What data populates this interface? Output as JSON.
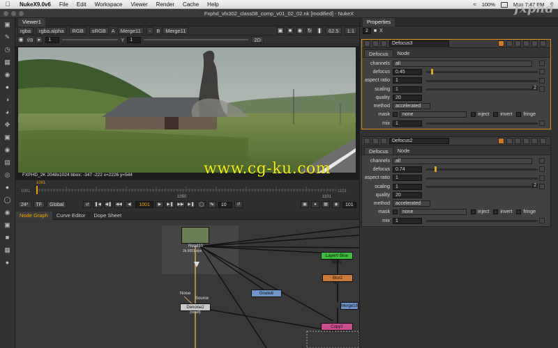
{
  "menubar": {
    "app": "NukeX9.0v6",
    "items": [
      "File",
      "Edit",
      "Workspace",
      "Viewer",
      "Render",
      "Cache",
      "Help"
    ],
    "status_percent": "100%",
    "clock": "Mon 7:47 PM"
  },
  "window": {
    "title": "Fxphd_vfx302_class08_comp_v01_02_02.nk [modified] - NukeX"
  },
  "logo": "fxphd",
  "viewer": {
    "tab": "Viewer1",
    "toolbar1": {
      "channels": "rgba",
      "alpha": "rgba.alpha",
      "colorspace_a": "RGB",
      "lut": "sRGB",
      "input_a_label": "A",
      "input_a": "Merge11",
      "input_b_sep": "-",
      "input_b_label": "B",
      "input_b": "Merge11",
      "zoom": "62.5",
      "ratio": "1:1"
    },
    "toolbar2": {
      "fstop": "f/8",
      "gain": "1",
      "gamma_label": "Y",
      "gamma": "1",
      "view": "2D"
    },
    "info": "FXPHD_2K 2048x1024  bbox: -347 -222   x=2226 y=544"
  },
  "timeline": {
    "start": "1001",
    "mid": "1050",
    "end": "1101",
    "current": "1001",
    "fps": "24*",
    "tf": "TF",
    "global": "Global",
    "skip": "10",
    "end_field": "101"
  },
  "watermark": "www.cg-ku.com",
  "nodegraph": {
    "tabs": [
      "Node Graph",
      "Curve Editor",
      "Dope Sheet"
    ],
    "nodes": {
      "read": "Read10",
      "read_sub": "2k.0001.dpx",
      "blue_layer": "Layer0 Blue layer",
      "blue_sub": "(rgba)",
      "blur": "Blur2",
      "blur_sub": "(all)",
      "grade": "Grade6",
      "merge": "Merge18",
      "denoise": "Denoise2",
      "denoise_sub": "(result)",
      "copy": "Copy1",
      "noise_label": "Noise",
      "source_label": "Source"
    }
  },
  "properties": {
    "tab": "Properties",
    "count": "2",
    "icon_x": "X",
    "panels": [
      {
        "name": "Defocus3",
        "tabs": [
          "Defocus",
          "Node"
        ],
        "channels": "all",
        "defocus": "0.45",
        "defocus_frac": 0.045,
        "aspect_ratio": "1",
        "scaling": "1",
        "scaling_right": "2",
        "quality": "20",
        "method": "accelerated",
        "mask": "none",
        "mask_opts": [
          "inject",
          "invert",
          "fringe"
        ],
        "mix": "1"
      },
      {
        "name": "Defocus2",
        "tabs": [
          "Defocus",
          "Node"
        ],
        "channels": "all",
        "defocus": "0.74",
        "defocus_frac": 0.074,
        "aspect_ratio": "1",
        "scaling": "1",
        "scaling_right": "2",
        "quality": "20",
        "method": "accelerated",
        "mask": "none",
        "mask_opts": [
          "inject",
          "invert",
          "fringe"
        ],
        "mix": "1"
      }
    ],
    "labels": {
      "channels": "channels",
      "defocus": "defocus",
      "aspect_ratio": "aspect ratio",
      "scaling": "scaling",
      "quality": "quality",
      "method": "method",
      "mask": "mask",
      "mix": "mix"
    }
  },
  "colors": {
    "accent_orange": "#e08a1c",
    "frame_text": "#f0a000",
    "watermark": "#f5f318",
    "node_green": "#3dbb3d",
    "node_orange": "#c97a3a",
    "node_blue": "#6f95c9",
    "node_pink": "#c94d8f"
  }
}
